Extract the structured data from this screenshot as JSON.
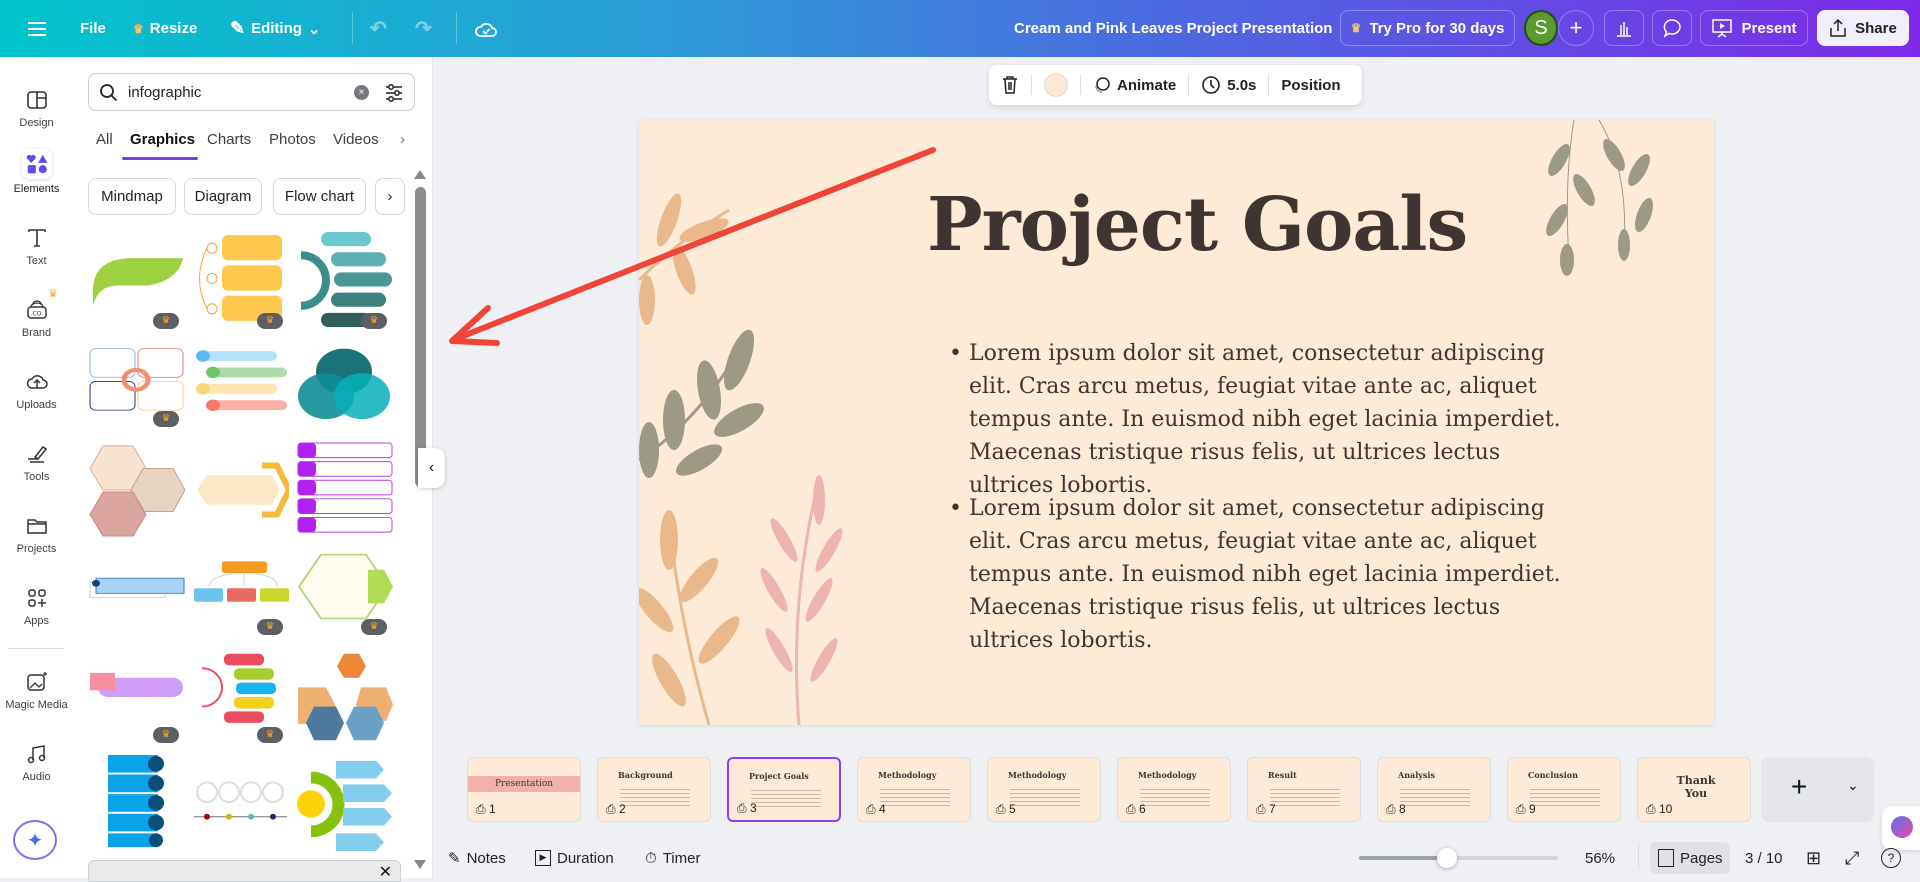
{
  "topbar": {
    "file": "File",
    "resize": "Resize",
    "editing": "Editing",
    "title": "Cream and Pink Leaves Project Presentation",
    "try_pro": "Try Pro for 30 days",
    "avatar": "S",
    "present": "Present",
    "share": "Share"
  },
  "rail": [
    {
      "label": "Design"
    },
    {
      "label": "Elements"
    },
    {
      "label": "Text"
    },
    {
      "label": "Brand"
    },
    {
      "label": "Uploads"
    },
    {
      "label": "Tools"
    },
    {
      "label": "Projects"
    },
    {
      "label": "Apps"
    },
    {
      "label": "Magic Media"
    },
    {
      "label": "Audio"
    }
  ],
  "panel": {
    "search_value": "infographic",
    "tabs": [
      "All",
      "Graphics",
      "Charts",
      "Photos",
      "Videos"
    ],
    "active_tab": "Graphics",
    "chips": [
      "Mindmap",
      "Diagram",
      "Flow chart"
    ],
    "graphics_premium": [
      true,
      true,
      true,
      true,
      false,
      false,
      false,
      false,
      false,
      false,
      true,
      true,
      true,
      true,
      false,
      false,
      false,
      false
    ]
  },
  "toolbar": {
    "animate": "Animate",
    "duration": "5.0s",
    "position": "Position",
    "color": "#fbe9d4"
  },
  "slide": {
    "title": "Project Goals",
    "bullets": [
      "Lorem ipsum dolor sit amet, consectetur adipiscing elit. Cras arcu metus, feugiat vitae ante ac, aliquet tempus ante. In euismod nibh eget lacinia imperdiet. Maecenas tristique risus felis, ut ultrices lectus ultrices lobortis.",
      "Lorem ipsum dolor sit amet, consectetur adipiscing elit. Cras arcu metus, feugiat vitae ante ac, aliquet tempus ante. In euismod nibh eget lacinia imperdiet. Maecenas tristique risus felis, ut ultrices lectus ultrices lobortis."
    ]
  },
  "pages": [
    {
      "title": "Presentation",
      "num": "1"
    },
    {
      "title": "Background",
      "num": "2"
    },
    {
      "title": "Project Goals",
      "num": "3"
    },
    {
      "title": "Methodology",
      "num": "4"
    },
    {
      "title": "Methodology",
      "num": "5"
    },
    {
      "title": "Methodology",
      "num": "6"
    },
    {
      "title": "Result",
      "num": "7"
    },
    {
      "title": "Analysis",
      "num": "8"
    },
    {
      "title": "Conclusion",
      "num": "9"
    },
    {
      "title": "Thank You",
      "num": "10"
    }
  ],
  "bottombar": {
    "notes": "Notes",
    "duration": "Duration",
    "timer": "Timer",
    "zoom": "56%",
    "zoom_fraction": 0.44,
    "pages": "Pages",
    "page_count": "3 / 10"
  }
}
